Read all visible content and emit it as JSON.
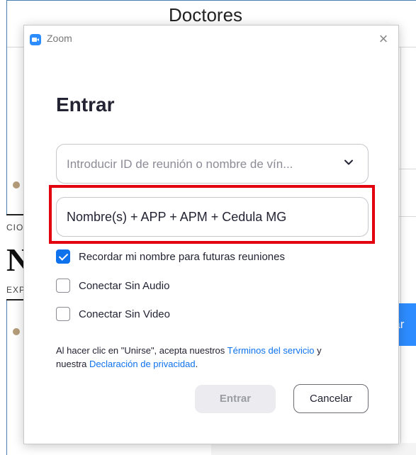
{
  "background": {
    "page_title": "Doctores",
    "logo_text_top": "CIO",
    "logo_text_mid": "NA",
    "logo_text_bottom": "EXP",
    "side_button_text": "Ingresar"
  },
  "dialog": {
    "app_title": "Zoom",
    "close_symbol": "×",
    "heading": "Entrar",
    "meeting_id_placeholder": "Introducir ID de reunión o nombre de vín...",
    "name_value": "Nombre(s) + APP + APM + Cedula MG",
    "options": [
      {
        "label": "Recordar mi nombre para futuras reuniones",
        "checked": true
      },
      {
        "label": "Conectar Sin Audio",
        "checked": false
      },
      {
        "label": "Conectar Sin Video",
        "checked": false
      }
    ],
    "terms": {
      "text1": "Al hacer clic en \"Unirse\", acepta nuestros ",
      "link1": "Términos del servicio",
      "text2": " y nuestra ",
      "link2": "Declaración de privacidad",
      "text3": "."
    },
    "join_button": "Entrar",
    "cancel_button": "Cancelar"
  },
  "colors": {
    "accent": "#0e72ed",
    "highlight": "#e3000f",
    "brand": "#2d8cff"
  },
  "icons": {
    "app": "zoom-logo-icon",
    "close": "close-icon",
    "dropdown": "chevron-down-icon",
    "checkbox": "check-icon"
  }
}
